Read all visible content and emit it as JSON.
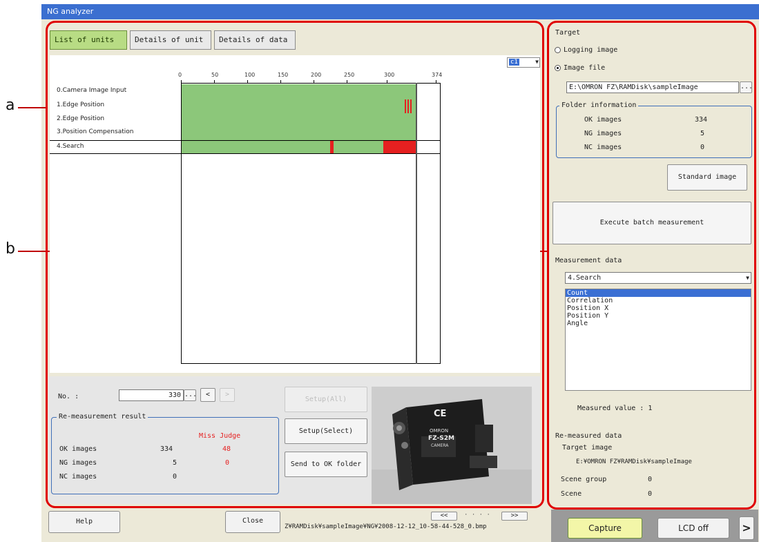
{
  "window": {
    "title": "NG analyzer"
  },
  "callouts": {
    "a": "a",
    "b": "b"
  },
  "tabs": [
    {
      "label": "List of units"
    },
    {
      "label": "Details of unit"
    },
    {
      "label": "Details of data"
    }
  ],
  "chart": {
    "camera_select": "c1",
    "axis_ticks": [
      "0",
      "50",
      "100",
      "150",
      "200",
      "250",
      "300",
      "374"
    ],
    "rows": [
      {
        "label": "0.Camera Image Input"
      },
      {
        "label": "1.Edge Position"
      },
      {
        "label": "2.Edge Position"
      },
      {
        "label": "3.Position Compensation"
      },
      {
        "label": "4.Search"
      }
    ],
    "colors": {
      "ok": "#8cc77a",
      "ng": "#e52020"
    }
  },
  "bottom": {
    "no_label": "No. :",
    "no_value": "330",
    "browse": "...",
    "prev": "<",
    "next": ">",
    "setup_all": "Setup(All)",
    "setup_select": "Setup(Select)",
    "send_ok": "Send to OK folder",
    "remeasure_title": "Re-measurement result",
    "miss_judge": "Miss Judge",
    "rows": [
      {
        "label": "OK images",
        "count": "334",
        "miss": "48"
      },
      {
        "label": "NG images",
        "count": "5",
        "miss": "0"
      },
      {
        "label": "NC images",
        "count": "0",
        "miss": ""
      }
    ],
    "camera_text": [
      "CE",
      "OMRON",
      "FZ-S2M",
      "CAMERA"
    ]
  },
  "right": {
    "target_label": "Target",
    "logging_image": "Logging image",
    "image_file": "Image file",
    "path": "E:\\OMRON FZ\\RAMDisk\\sampleImage",
    "browse": "...",
    "folder_info_title": "Folder information",
    "folder_rows": [
      {
        "label": "OK images",
        "value": "334"
      },
      {
        "label": "NG images",
        "value": "5"
      },
      {
        "label": "NC images",
        "value": "0"
      }
    ],
    "standard_image": "Standard image",
    "execute_batch": "Execute batch measurement",
    "measurement_data_label": "Measurement data",
    "unit_select": "4.Search",
    "list_items": [
      "Count",
      "Correlation",
      "Position X",
      "Position Y",
      "Angle"
    ],
    "measured_value": "Measured value : 1",
    "remeasured_data": "Re-measured data",
    "target_image_label": "Target image",
    "target_image_path": "E:¥OMRON FZ¥RAMDisk¥sampleImage",
    "scene_group_label": "Scene group",
    "scene_group_value": "0",
    "scene_label": "Scene",
    "scene_value": "0"
  },
  "footer": {
    "help": "Help",
    "close": "Close",
    "file_path": "Z¥RAMDisk¥sampleImage¥NG¥2008-12-12_10-58-44-528_0.bmp",
    "nav_first": "<<",
    "nav_dots": "· · · ·",
    "nav_last": ">>",
    "capture": "Capture",
    "lcd_off": "LCD off",
    "more": ">"
  }
}
